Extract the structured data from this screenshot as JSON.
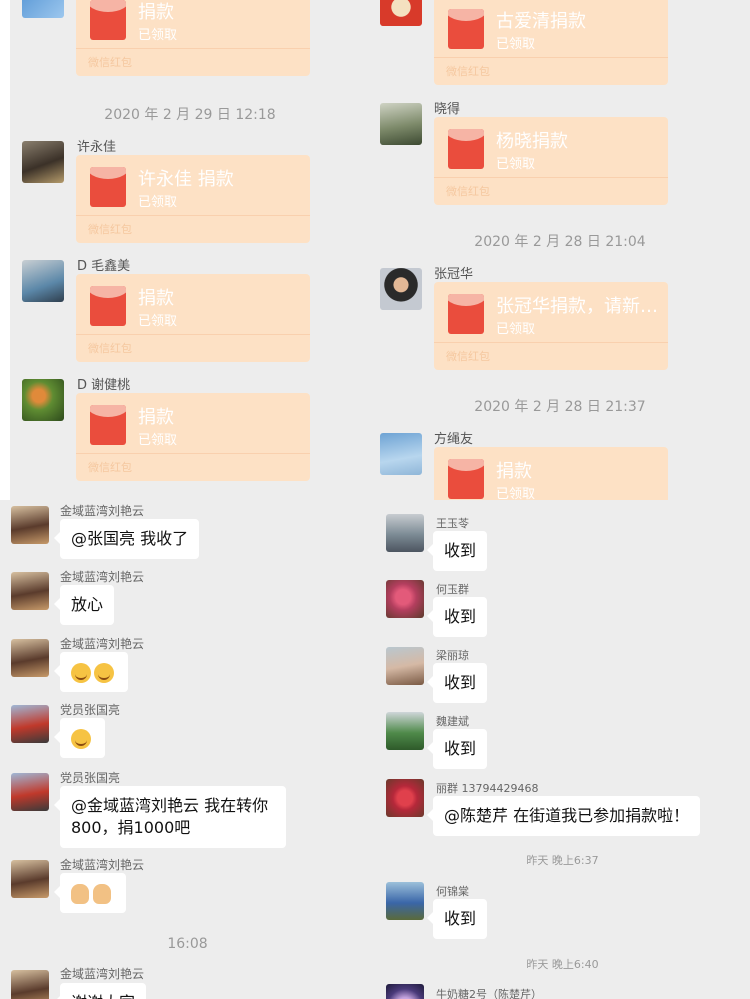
{
  "top_left": {
    "rp1": {
      "title": "捐款",
      "sub": "已领取",
      "foot": "微信红包"
    },
    "ts1": "2020 年 2 月 29 日 12:18",
    "msg1": {
      "name": "许永佳",
      "title": "许永佳 捐款",
      "sub": "已领取",
      "foot": "微信红包"
    },
    "msg2": {
      "name": "D 毛鑫美",
      "title": "捐款",
      "sub": "已领取",
      "foot": "微信红包"
    },
    "msg3": {
      "name": "D 谢健桃",
      "title": "捐款",
      "sub": "已领取",
      "foot": "微信红包"
    }
  },
  "top_right": {
    "rp1": {
      "title": "古爱清捐款",
      "sub": "已领取",
      "foot": "微信红包"
    },
    "msg1": {
      "name": "晓得",
      "title": "杨晓捐款",
      "sub": "已领取",
      "foot": "微信红包"
    },
    "ts1": "2020 年 2 月 28 日 21:04",
    "msg2": {
      "name": "张冠华",
      "title": "张冠华捐款，请新…",
      "sub": "已领取",
      "foot": "微信红包"
    },
    "ts2": "2020 年 2 月 28 日 21:37",
    "msg3": {
      "name": "方绳友",
      "title": "捐款",
      "sub": "已领取"
    }
  },
  "bottom_left": {
    "msgs": [
      {
        "name": "金域蓝湾刘艳云",
        "text": "@张国亮 我收了"
      },
      {
        "name": "金域蓝湾刘艳云",
        "text": "放心"
      },
      {
        "name": "金域蓝湾刘艳云",
        "text": ""
      },
      {
        "name": "党员张国亮",
        "text": ""
      },
      {
        "name": "党员张国亮",
        "text": "@金域蓝湾刘艳云 我在转你800，捐1000吧"
      },
      {
        "name": "金域蓝湾刘艳云",
        "text": ""
      }
    ],
    "ts1": "16:08",
    "last": {
      "name": "金域蓝湾刘艳云",
      "text": "谢谢大家"
    }
  },
  "bottom_right": {
    "msgs": [
      {
        "name": "王玉苓",
        "text": "收到"
      },
      {
        "name": "何玉群",
        "text": "收到"
      },
      {
        "name": "梁丽琼",
        "text": "收到"
      },
      {
        "name": "魏建斌",
        "text": "收到"
      },
      {
        "name": "丽群 13794429468",
        "text": "@陈楚芹 在街道我已参加捐款啦！"
      }
    ],
    "ts1": "昨天 晚上6:37",
    "msg6": {
      "name": "何锦棠",
      "text": "收到"
    },
    "ts2": "昨天 晚上6:40",
    "msg7": {
      "name": "牛奶糖2号（陈楚芹）"
    }
  },
  "colors": {
    "panel_bg": "#ededed",
    "redpacket": "#fde1c5",
    "envelope": "#ea4d3d",
    "bubble": "#ffffff"
  }
}
